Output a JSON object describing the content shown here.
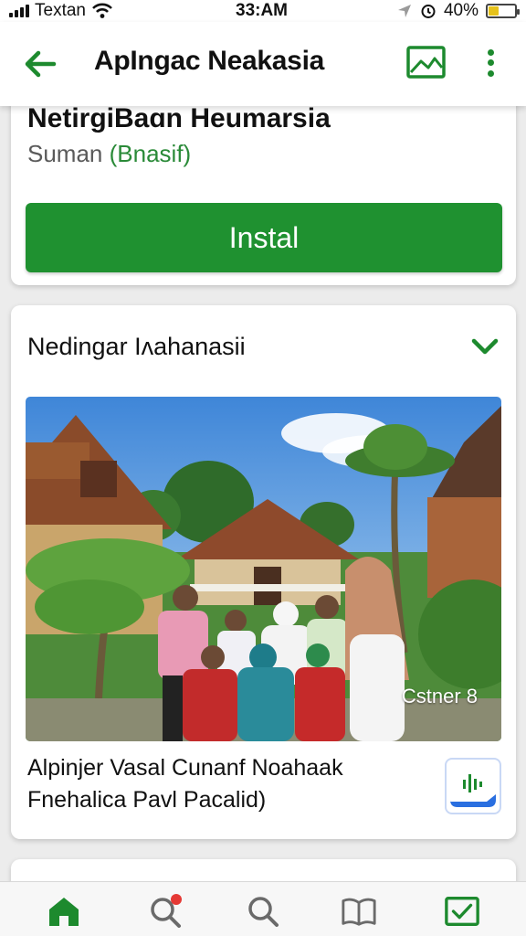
{
  "status_bar": {
    "carrier": "Textan",
    "time": "33:AM",
    "battery": "40%",
    "battery_level": 0.4,
    "icons": [
      "signal-icon",
      "wifi-icon",
      "location-icon",
      "alarm-icon",
      "battery-icon"
    ]
  },
  "app_bar": {
    "title": "ApIngac Neakasia",
    "icons": [
      "back-arrow-icon",
      "image-gallery-icon",
      "more-vertical-icon"
    ]
  },
  "app_card": {
    "name": "NetirgiBaɑn Heumarsia",
    "developer": "Suman",
    "developer_tag": "(Bnasif)",
    "install_label": "Instal"
  },
  "news_card": {
    "title": "Nedingar Iʌahanasii",
    "image_badge": "Cstner 8",
    "caption_line1": "Alpinjer Vasal Cunanf Noahaak",
    "caption_line2": "Fnehalica Pavl Pacalid)",
    "icons": [
      "chevron-down-icon",
      "audio-wave-icon"
    ]
  },
  "bottom_nav": {
    "items": [
      "home-icon",
      "search-notification-icon",
      "search-icon",
      "book-icon",
      "mail-check-icon"
    ],
    "active": "home-icon"
  },
  "colors": {
    "accent": "#1f9130",
    "accent_dark": "#1d8a2e",
    "notification": "#e53935"
  }
}
